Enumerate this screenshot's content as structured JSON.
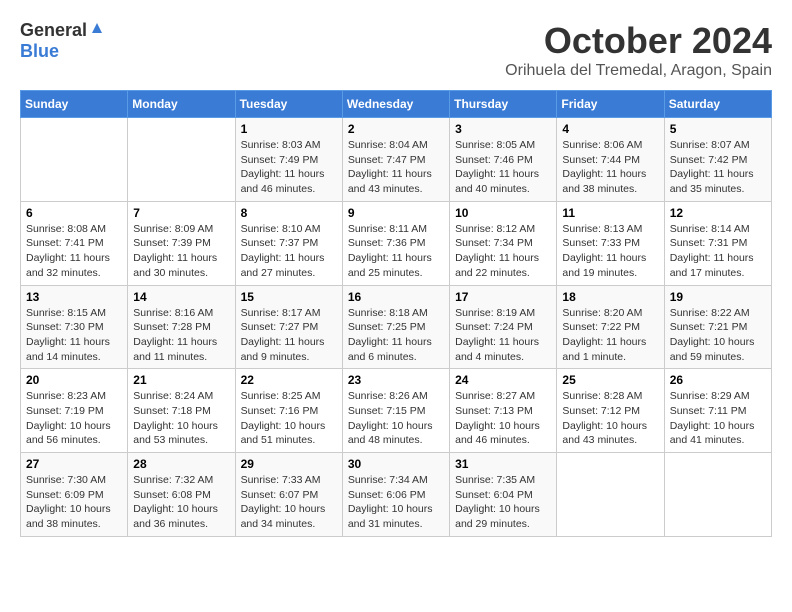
{
  "header": {
    "logo_general": "General",
    "logo_blue": "Blue",
    "month_title": "October 2024",
    "location": "Orihuela del Tremedal, Aragon, Spain"
  },
  "days_of_week": [
    "Sunday",
    "Monday",
    "Tuesday",
    "Wednesday",
    "Thursday",
    "Friday",
    "Saturday"
  ],
  "weeks": [
    [
      {
        "day": "",
        "detail": ""
      },
      {
        "day": "",
        "detail": ""
      },
      {
        "day": "1",
        "detail": "Sunrise: 8:03 AM\nSunset: 7:49 PM\nDaylight: 11 hours and 46 minutes."
      },
      {
        "day": "2",
        "detail": "Sunrise: 8:04 AM\nSunset: 7:47 PM\nDaylight: 11 hours and 43 minutes."
      },
      {
        "day": "3",
        "detail": "Sunrise: 8:05 AM\nSunset: 7:46 PM\nDaylight: 11 hours and 40 minutes."
      },
      {
        "day": "4",
        "detail": "Sunrise: 8:06 AM\nSunset: 7:44 PM\nDaylight: 11 hours and 38 minutes."
      },
      {
        "day": "5",
        "detail": "Sunrise: 8:07 AM\nSunset: 7:42 PM\nDaylight: 11 hours and 35 minutes."
      }
    ],
    [
      {
        "day": "6",
        "detail": "Sunrise: 8:08 AM\nSunset: 7:41 PM\nDaylight: 11 hours and 32 minutes."
      },
      {
        "day": "7",
        "detail": "Sunrise: 8:09 AM\nSunset: 7:39 PM\nDaylight: 11 hours and 30 minutes."
      },
      {
        "day": "8",
        "detail": "Sunrise: 8:10 AM\nSunset: 7:37 PM\nDaylight: 11 hours and 27 minutes."
      },
      {
        "day": "9",
        "detail": "Sunrise: 8:11 AM\nSunset: 7:36 PM\nDaylight: 11 hours and 25 minutes."
      },
      {
        "day": "10",
        "detail": "Sunrise: 8:12 AM\nSunset: 7:34 PM\nDaylight: 11 hours and 22 minutes."
      },
      {
        "day": "11",
        "detail": "Sunrise: 8:13 AM\nSunset: 7:33 PM\nDaylight: 11 hours and 19 minutes."
      },
      {
        "day": "12",
        "detail": "Sunrise: 8:14 AM\nSunset: 7:31 PM\nDaylight: 11 hours and 17 minutes."
      }
    ],
    [
      {
        "day": "13",
        "detail": "Sunrise: 8:15 AM\nSunset: 7:30 PM\nDaylight: 11 hours and 14 minutes."
      },
      {
        "day": "14",
        "detail": "Sunrise: 8:16 AM\nSunset: 7:28 PM\nDaylight: 11 hours and 11 minutes."
      },
      {
        "day": "15",
        "detail": "Sunrise: 8:17 AM\nSunset: 7:27 PM\nDaylight: 11 hours and 9 minutes."
      },
      {
        "day": "16",
        "detail": "Sunrise: 8:18 AM\nSunset: 7:25 PM\nDaylight: 11 hours and 6 minutes."
      },
      {
        "day": "17",
        "detail": "Sunrise: 8:19 AM\nSunset: 7:24 PM\nDaylight: 11 hours and 4 minutes."
      },
      {
        "day": "18",
        "detail": "Sunrise: 8:20 AM\nSunset: 7:22 PM\nDaylight: 11 hours and 1 minute."
      },
      {
        "day": "19",
        "detail": "Sunrise: 8:22 AM\nSunset: 7:21 PM\nDaylight: 10 hours and 59 minutes."
      }
    ],
    [
      {
        "day": "20",
        "detail": "Sunrise: 8:23 AM\nSunset: 7:19 PM\nDaylight: 10 hours and 56 minutes."
      },
      {
        "day": "21",
        "detail": "Sunrise: 8:24 AM\nSunset: 7:18 PM\nDaylight: 10 hours and 53 minutes."
      },
      {
        "day": "22",
        "detail": "Sunrise: 8:25 AM\nSunset: 7:16 PM\nDaylight: 10 hours and 51 minutes."
      },
      {
        "day": "23",
        "detail": "Sunrise: 8:26 AM\nSunset: 7:15 PM\nDaylight: 10 hours and 48 minutes."
      },
      {
        "day": "24",
        "detail": "Sunrise: 8:27 AM\nSunset: 7:13 PM\nDaylight: 10 hours and 46 minutes."
      },
      {
        "day": "25",
        "detail": "Sunrise: 8:28 AM\nSunset: 7:12 PM\nDaylight: 10 hours and 43 minutes."
      },
      {
        "day": "26",
        "detail": "Sunrise: 8:29 AM\nSunset: 7:11 PM\nDaylight: 10 hours and 41 minutes."
      }
    ],
    [
      {
        "day": "27",
        "detail": "Sunrise: 7:30 AM\nSunset: 6:09 PM\nDaylight: 10 hours and 38 minutes."
      },
      {
        "day": "28",
        "detail": "Sunrise: 7:32 AM\nSunset: 6:08 PM\nDaylight: 10 hours and 36 minutes."
      },
      {
        "day": "29",
        "detail": "Sunrise: 7:33 AM\nSunset: 6:07 PM\nDaylight: 10 hours and 34 minutes."
      },
      {
        "day": "30",
        "detail": "Sunrise: 7:34 AM\nSunset: 6:06 PM\nDaylight: 10 hours and 31 minutes."
      },
      {
        "day": "31",
        "detail": "Sunrise: 7:35 AM\nSunset: 6:04 PM\nDaylight: 10 hours and 29 minutes."
      },
      {
        "day": "",
        "detail": ""
      },
      {
        "day": "",
        "detail": ""
      }
    ]
  ]
}
